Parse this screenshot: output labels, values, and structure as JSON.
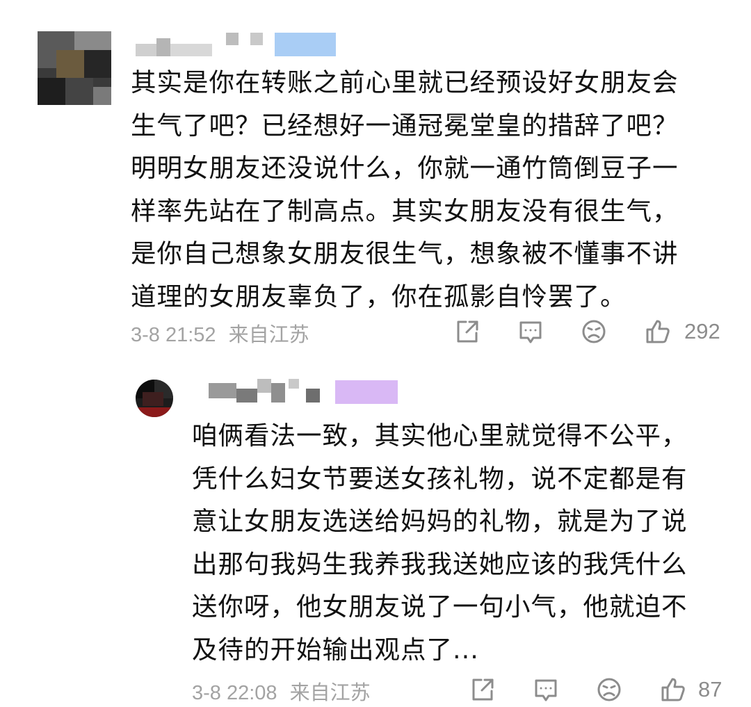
{
  "comment": {
    "text_lines": [
      "其实是你在转账之前心里就已经预设好女朋友会",
      "生气了吧？已经想好一通冠冕堂皇的措辞了吧？",
      "明明女朋友还没说什么，你就一通竹筒倒豆子一",
      "样率先站在了制高点。其实女朋友没有很生气，",
      "是你自己想象女朋友很生气，想象被不懂事不讲",
      "道理的女朋友辜负了，你在孤影自怜罢了。"
    ],
    "timestamp": "3-8 21:52",
    "location": "来自江苏",
    "like_count": "292",
    "icons": [
      "share-icon",
      "comment-icon",
      "dislike-icon",
      "like-icon"
    ]
  },
  "reply": {
    "text_lines": [
      "咱俩看法一致，其实他心里就觉得不公平，",
      "凭什么妇女节要送女孩礼物，说不定都是有",
      "意让女朋友选送给妈妈的礼物，就是为了说",
      "出那句我妈生我养我我送她应该的我凭什么",
      "送你呀，他女朋友说了一句小气，他就迫不",
      "及待的开始输出观点了..."
    ],
    "timestamp": "3-8 22:08",
    "location": "来自江苏",
    "like_count": "87",
    "icons": [
      "share-icon",
      "comment-icon",
      "dislike-icon",
      "like-icon"
    ]
  },
  "colors": {
    "text": "#111111",
    "meta": "#a3a3a3",
    "icon": "#8c8c8c",
    "background": "#ffffff",
    "badge_main": "#a9cdf5",
    "badge_reply": "#d9b8f5"
  }
}
